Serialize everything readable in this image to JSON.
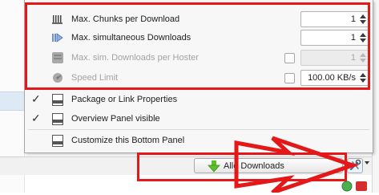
{
  "menu": {
    "settings": [
      {
        "label": "Max. Chunks per Download",
        "value": "1",
        "icon": "chunks-icon",
        "enabled": true,
        "checkbox": false
      },
      {
        "label": "Max. simultaneous Downloads",
        "value": "1",
        "icon": "play-icon",
        "enabled": true,
        "checkbox": false
      },
      {
        "label": "Max. sim. Downloads per Hoster",
        "value": "1",
        "icon": "hoster-icon",
        "enabled": false,
        "checkbox": true
      },
      {
        "label": "Speed Limit",
        "value": "100.00 KB/s",
        "icon": "speed-icon",
        "enabled": false,
        "checkbox": true
      }
    ],
    "toggles": [
      {
        "label": "Package or Link Properties",
        "checked": true
      },
      {
        "label": "Overview Panel visible",
        "checked": true
      }
    ],
    "customize_label": "Customize this Bottom Panel"
  },
  "bottombar": {
    "download_button_label": "Alle Downloads"
  },
  "colors": {
    "annotation": "#e41818",
    "download_arrow": "#5fbf2a"
  }
}
